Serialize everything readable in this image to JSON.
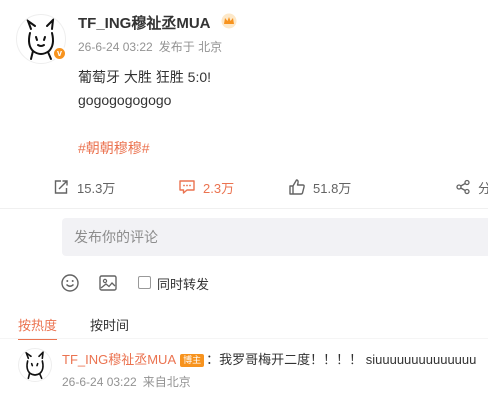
{
  "post": {
    "username": "TF_ING穆祉丞MUA",
    "time": "26-6-24 03:22",
    "source": "发布于 北京",
    "lines": [
      "葡萄牙 大胜 狂胜 5:0!",
      "gogogogogogo"
    ],
    "hashtag": "#朝朝穆穆#",
    "verified_badge": "v"
  },
  "actions": {
    "share": {
      "icon": "share-box-icon",
      "label": "15.3万"
    },
    "comment": {
      "icon": "comment-bubble-icon",
      "label": "2.3万",
      "color": "#eb7350"
    },
    "like": {
      "icon": "thumbs-up-icon",
      "label": "51.8万"
    },
    "forward": {
      "icon": "share-nodes-icon",
      "label": "分"
    }
  },
  "composer": {
    "placeholder": "发布你的评论",
    "forward_label": "同时转发",
    "forward_checked": false
  },
  "sort": {
    "hot_label": "按热度",
    "time_label": "按时间",
    "active": "hot"
  },
  "comment": {
    "username": "TF_ING穆祉丞MUA",
    "tag": "博主",
    "text": "：我罗哥梅开二度！！！！ siuuuuuuuuuuuuuu",
    "time": "26-6-24 03:22",
    "location": "来自北京"
  },
  "colors": {
    "accent": "#eb7350",
    "badge": "#f7931e",
    "muted": "#939393"
  }
}
